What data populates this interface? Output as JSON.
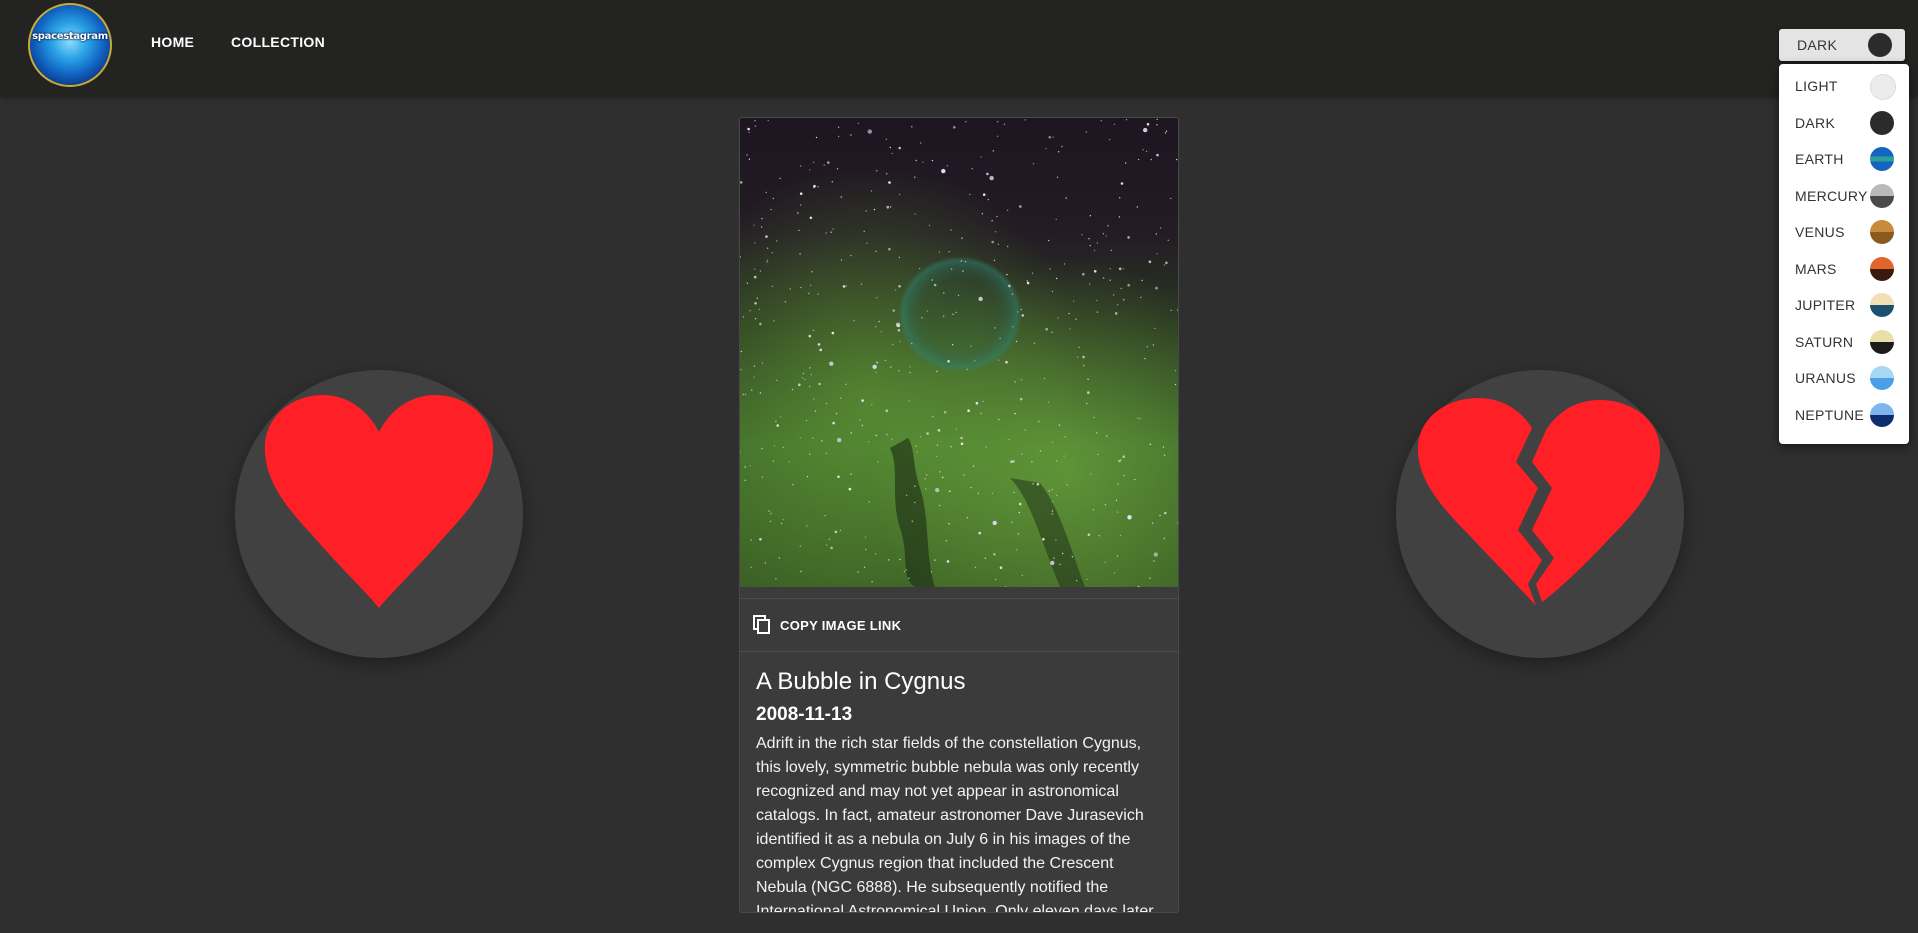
{
  "app": {
    "logo_text": "spacestagram"
  },
  "nav": {
    "home": "HOME",
    "collection": "COLLECTION"
  },
  "theme": {
    "selected": "DARK",
    "options": [
      {
        "label": "LIGHT",
        "colors": [
          "#ececec",
          "#ececec"
        ]
      },
      {
        "label": "DARK",
        "colors": [
          "#2b2b2b",
          "#2b2b2b"
        ]
      },
      {
        "label": "EARTH",
        "colors": [
          "#1565c0",
          "#2aa198",
          "#1565c0"
        ]
      },
      {
        "label": "MERCURY",
        "colors": [
          "#b9b9b9",
          "#4a4a4a"
        ]
      },
      {
        "label": "VENUS",
        "colors": [
          "#c98a3c",
          "#8a5a1e"
        ]
      },
      {
        "label": "MARS",
        "colors": [
          "#e0642c",
          "#3a1a0e"
        ]
      },
      {
        "label": "JUPITER",
        "colors": [
          "#f1dfb6",
          "#1f4f6f"
        ]
      },
      {
        "label": "SATURN",
        "colors": [
          "#eadfa9",
          "#1b1b1b"
        ]
      },
      {
        "label": "URANUS",
        "colors": [
          "#a6d8f5",
          "#4b9fe6"
        ]
      },
      {
        "label": "NEPTUNE",
        "colors": [
          "#7fb5ef",
          "#0c2e6c"
        ]
      }
    ]
  },
  "vote": {
    "like_icon": "heart-icon",
    "dislike_icon": "broken-heart-icon",
    "heart_color": "#ff1f26"
  },
  "card": {
    "copy_label": "COPY IMAGE LINK",
    "title": "A Bubble in Cygnus",
    "date": "2008-11-13",
    "description": "Adrift in the rich star fields of the constellation Cygnus, this lovely, symmetric bubble nebula was only recently recognized and may not yet appear in astronomical catalogs. In fact, amateur astronomer Dave Jurasevich identified it as a nebula on July 6 in his images of the complex Cygnus region that included the Crescent Nebula (NGC 6888). He subsequently notified the International Astronomical Union. Only eleven days later"
  }
}
